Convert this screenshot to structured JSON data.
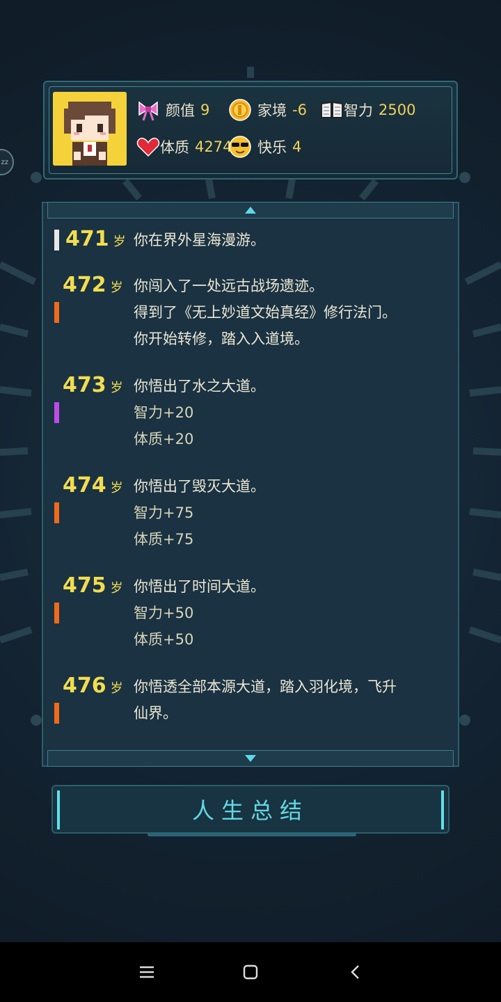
{
  "stats": [
    {
      "id": "looks",
      "label": "颜值",
      "value": "9",
      "icon": "ribbon-icon"
    },
    {
      "id": "family",
      "label": "家境",
      "value": "-6",
      "icon": "coin-icon"
    },
    {
      "id": "intellect",
      "label": "智力",
      "value": "2500",
      "icon": "book-icon"
    },
    {
      "id": "physique",
      "label": "体质",
      "value": "4274",
      "icon": "heart-icon"
    },
    {
      "id": "happiness",
      "label": "快乐",
      "value": "4",
      "icon": "sunglasses-face-icon"
    }
  ],
  "age_unit": "岁",
  "log": [
    {
      "age": "471",
      "marker_color": "#e8e8e8",
      "lines": [
        "你在界外星海漫游。"
      ]
    },
    {
      "age": "472",
      "marker_color": "#f06a1a",
      "lines": [
        "你闯入了一处远古战场遗迹。",
        "得到了《无上妙道文始真经》修行法门。",
        "你开始转修，踏入入道境。"
      ]
    },
    {
      "age": "473",
      "marker_color": "#c04ae8",
      "lines": [
        "你悟出了水之大道。",
        "智力+20",
        "体质+20"
      ]
    },
    {
      "age": "474",
      "marker_color": "#f06a1a",
      "lines": [
        "你悟出了毁灭大道。",
        "智力+75",
        "体质+75"
      ]
    },
    {
      "age": "475",
      "marker_color": "#f06a1a",
      "lines": [
        "你悟出了时间大道。",
        "智力+50",
        "体质+50"
      ]
    },
    {
      "age": "476",
      "marker_color": "#f06a1a",
      "lines": [
        "你悟透全部本源大道，踏入羽化境，飞升",
        "仙界。"
      ]
    }
  ],
  "summary_button": "人生总结",
  "side_badge": "zz"
}
